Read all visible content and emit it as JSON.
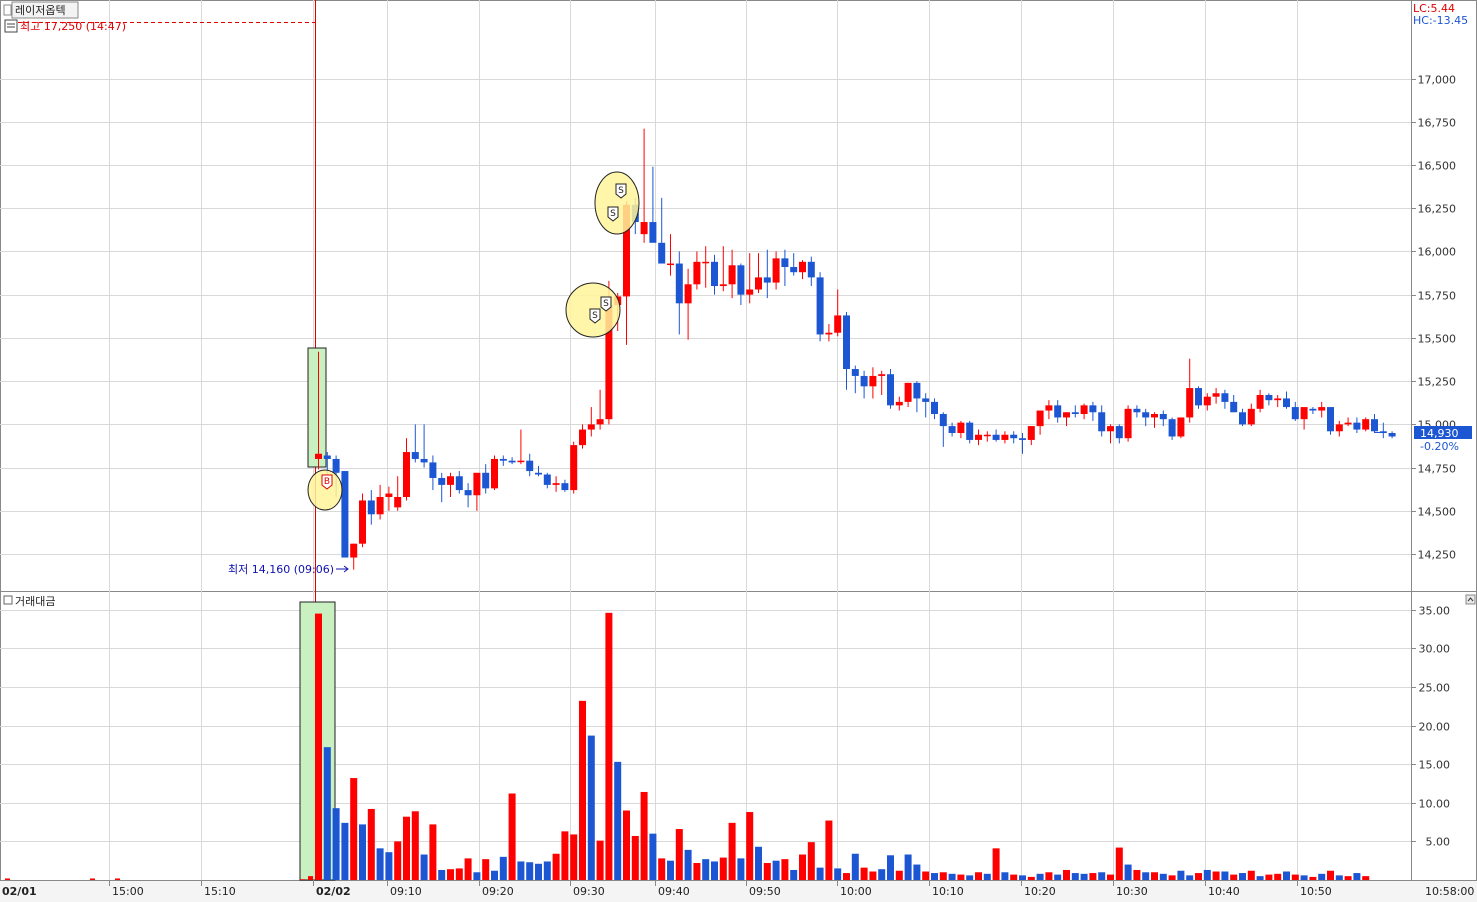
{
  "colors": {
    "up": "#ff0000",
    "down": "#1c56d2",
    "grid": "#d9d9d9",
    "highlight": "#c8f0c0",
    "marker_fill": "#fff59a"
  },
  "legend": {
    "stock_name": "레이저옵텍",
    "high_label": "최고 17,250 (14:47)",
    "low_label": "최저 14,160 (09:06)",
    "lc": "LC:5.44",
    "hc": "HC:-13.45",
    "current_price": "14,930",
    "current_change": "-0.20%",
    "volume_panel": "거래대금"
  },
  "chart_data": [
    {
      "type": "candlestick",
      "price_axis": {
        "min": 14100,
        "max": 17350,
        "ticks": [
          "14,250",
          "14,500",
          "14,750",
          "15,000",
          "15,250",
          "15,500",
          "15,750",
          "16,000",
          "16,250",
          "16,500",
          "16,750",
          "17,000"
        ]
      },
      "x_tick_labels": [
        "02/01",
        "15:00",
        "15:10",
        "02/02",
        "09:10",
        "09:20",
        "09:30",
        "09:40",
        "09:50",
        "10:00",
        "10:10",
        "10:20",
        "10:30",
        "10:40",
        "10:50",
        "10:58:00"
      ],
      "ohlc": [
        [
          14800,
          15420,
          14740,
          14830
        ],
        [
          14820,
          14840,
          14700,
          14800
        ],
        [
          14800,
          14820,
          14580,
          14720
        ],
        [
          14730,
          14730,
          14230,
          14230
        ],
        [
          14230,
          14310,
          14160,
          14310
        ],
        [
          14310,
          14600,
          14290,
          14560
        ],
        [
          14560,
          14620,
          14420,
          14480
        ],
        [
          14480,
          14650,
          14450,
          14580
        ],
        [
          14580,
          14640,
          14500,
          14600
        ],
        [
          14520,
          14700,
          14500,
          14580
        ],
        [
          14580,
          14920,
          14560,
          14840
        ],
        [
          14840,
          15000,
          14780,
          14800
        ],
        [
          14800,
          15000,
          14750,
          14780
        ],
        [
          14780,
          14820,
          14620,
          14690
        ],
        [
          14690,
          14720,
          14550,
          14650
        ],
        [
          14650,
          14720,
          14580,
          14700
        ],
        [
          14700,
          14730,
          14600,
          14620
        ],
        [
          14620,
          14660,
          14520,
          14590
        ],
        [
          14590,
          14700,
          14500,
          14720
        ],
        [
          14720,
          14770,
          14600,
          14630
        ],
        [
          14630,
          14820,
          14620,
          14800
        ],
        [
          14800,
          14820,
          14760,
          14790
        ],
        [
          14790,
          14810,
          14770,
          14780
        ],
        [
          14790,
          14970,
          14770,
          14790
        ],
        [
          14790,
          14830,
          14700,
          14730
        ],
        [
          14720,
          14760,
          14700,
          14710
        ],
        [
          14710,
          14720,
          14630,
          14650
        ],
        [
          14650,
          14700,
          14610,
          14660
        ],
        [
          14660,
          14680,
          14610,
          14620
        ],
        [
          14620,
          14900,
          14600,
          14880
        ],
        [
          14880,
          15000,
          14860,
          14970
        ],
        [
          14970,
          15100,
          14930,
          15000
        ],
        [
          15000,
          15200,
          14970,
          15030
        ],
        [
          15030,
          15830,
          15000,
          15690
        ],
        [
          15690,
          15760,
          15540,
          15740
        ],
        [
          15740,
          16290,
          15460,
          16270
        ],
        [
          16270,
          16310,
          16100,
          16170
        ],
        [
          16100,
          16710,
          16050,
          16170
        ],
        [
          16170,
          16490,
          16110,
          16050
        ],
        [
          16050,
          16310,
          15960,
          15930
        ],
        [
          15930,
          16100,
          15860,
          15930
        ],
        [
          15930,
          16000,
          15520,
          15700
        ],
        [
          15700,
          15900,
          15490,
          15810
        ],
        [
          15810,
          16000,
          15780,
          15940
        ],
        [
          15940,
          16030,
          15790,
          15940
        ],
        [
          15940,
          15980,
          15750,
          15800
        ],
        [
          15800,
          16030,
          15770,
          15810
        ],
        [
          15810,
          16010,
          15730,
          15920
        ],
        [
          15920,
          15930,
          15690,
          15750
        ],
        [
          15750,
          15990,
          15700,
          15780
        ],
        [
          15780,
          15990,
          15760,
          15850
        ],
        [
          15850,
          16010,
          15730,
          15820
        ],
        [
          15820,
          16000,
          15780,
          15960
        ],
        [
          15960,
          16010,
          15800,
          15910
        ],
        [
          15910,
          15990,
          15860,
          15880
        ],
        [
          15880,
          15950,
          15840,
          15940
        ],
        [
          15940,
          15970,
          15800,
          15850
        ],
        [
          15850,
          15880,
          15480,
          15520
        ],
        [
          15520,
          15580,
          15480,
          15530
        ],
        [
          15530,
          15780,
          15510,
          15630
        ],
        [
          15630,
          15650,
          15200,
          15320
        ],
        [
          15320,
          15340,
          15180,
          15280
        ],
        [
          15280,
          15310,
          15150,
          15220
        ],
        [
          15220,
          15330,
          15150,
          15280
        ],
        [
          15280,
          15310,
          15170,
          15290
        ],
        [
          15290,
          15320,
          15090,
          15110
        ],
        [
          15110,
          15160,
          15080,
          15130
        ],
        [
          15130,
          15240,
          15100,
          15240
        ],
        [
          15240,
          15250,
          15070,
          15150
        ],
        [
          15150,
          15180,
          15040,
          15130
        ],
        [
          15130,
          15150,
          15030,
          15060
        ],
        [
          15060,
          15070,
          14870,
          14990
        ],
        [
          14990,
          15010,
          14930,
          14950
        ],
        [
          14950,
          15020,
          14920,
          15010
        ],
        [
          15010,
          15020,
          14890,
          14910
        ],
        [
          14910,
          14970,
          14880,
          14940
        ],
        [
          14940,
          14960,
          14900,
          14940
        ],
        [
          14940,
          14970,
          14900,
          14910
        ],
        [
          14910,
          14960,
          14890,
          14940
        ],
        [
          14940,
          14960,
          14890,
          14920
        ],
        [
          14920,
          14950,
          14830,
          14910
        ],
        [
          14910,
          14990,
          14880,
          14990
        ],
        [
          14990,
          15050,
          14940,
          15080
        ],
        [
          15080,
          15140,
          15030,
          15110
        ],
        [
          15110,
          15140,
          15010,
          15040
        ],
        [
          15040,
          15070,
          14990,
          15070
        ],
        [
          15070,
          15110,
          15040,
          15060
        ],
        [
          15060,
          15120,
          15030,
          15110
        ],
        [
          15110,
          15130,
          15020,
          15070
        ],
        [
          15070,
          15110,
          14930,
          14960
        ],
        [
          14960,
          15000,
          14890,
          14990
        ],
        [
          14990,
          15000,
          14890,
          14920
        ],
        [
          14920,
          15110,
          14900,
          15090
        ],
        [
          15090,
          15110,
          15040,
          15070
        ],
        [
          15070,
          15090,
          14990,
          15040
        ],
        [
          15040,
          15070,
          14980,
          15060
        ],
        [
          15060,
          15080,
          14990,
          15030
        ],
        [
          15030,
          15040,
          14910,
          14930
        ],
        [
          14930,
          15020,
          14920,
          15040
        ],
        [
          15040,
          15380,
          15010,
          15210
        ],
        [
          15210,
          15220,
          15090,
          15110
        ],
        [
          15110,
          15180,
          15080,
          15160
        ],
        [
          15160,
          15210,
          15120,
          15180
        ],
        [
          15180,
          15200,
          15090,
          15130
        ],
        [
          15130,
          15170,
          15080,
          15070
        ],
        [
          15070,
          15090,
          14990,
          15000
        ],
        [
          15000,
          15120,
          14990,
          15090
        ],
        [
          15090,
          15200,
          15070,
          15170
        ],
        [
          15170,
          15180,
          15110,
          15140
        ],
        [
          15140,
          15170,
          15100,
          15150
        ],
        [
          15150,
          15190,
          15090,
          15100
        ],
        [
          15100,
          15130,
          15020,
          15030
        ],
        [
          15030,
          15090,
          14970,
          15100
        ],
        [
          15090,
          15100,
          15060,
          15080
        ],
        [
          15080,
          15130,
          15040,
          15100
        ],
        [
          15100,
          15100,
          14940,
          14960
        ],
        [
          14960,
          15020,
          14930,
          15000
        ],
        [
          15000,
          15040,
          14990,
          15010
        ],
        [
          15010,
          15040,
          14950,
          14970
        ],
        [
          14970,
          15040,
          14960,
          15030
        ],
        [
          15030,
          15060,
          14950,
          14960
        ],
        [
          14960,
          15010,
          14920,
          14950
        ],
        [
          14950,
          14960,
          14920,
          14930
        ]
      ],
      "signals": [
        {
          "label": "B",
          "bar": 0
        },
        {
          "label": "S",
          "bar": 34
        },
        {
          "label": "S",
          "bar": 34
        },
        {
          "label": "S",
          "bar": 37
        },
        {
          "label": "S",
          "bar": 36
        }
      ]
    },
    {
      "type": "bar",
      "title": "거래대금",
      "y_axis": {
        "min": 0,
        "max": 36,
        "ticks": [
          "5.00",
          "10.00",
          "15.00",
          "20.00",
          "25.00",
          "30.00",
          "35.00"
        ]
      },
      "values": [
        34.5,
        17.2,
        9.3,
        7.4,
        13.2,
        7.2,
        9.2,
        4.1,
        3.6,
        5.0,
        8.2,
        8.9,
        3.3,
        7.2,
        1.3,
        1.4,
        1.5,
        2.8,
        1.0,
        2.7,
        1.2,
        3.0,
        11.2,
        2.4,
        2.3,
        2.1,
        2.4,
        3.4,
        6.3,
        5.9,
        23.2,
        18.7,
        5.1,
        34.6,
        15.3,
        9.0,
        5.7,
        11.4,
        6.0,
        2.8,
        2.5,
        6.6,
        3.9,
        2.2,
        2.7,
        2.4,
        2.9,
        7.4,
        2.8,
        8.8,
        4.3,
        2.2,
        2.5,
        2.7,
        1.3,
        3.3,
        4.9,
        1.6,
        7.7,
        1.5,
        0.9,
        3.4,
        1.6,
        1.1,
        1.4,
        3.2,
        1.2,
        3.3,
        2.0,
        1.1,
        0.9,
        1.0,
        0.8,
        0.7,
        0.6,
        1.0,
        0.8,
        4.1,
        1.0,
        0.7,
        0.6,
        0.4,
        0.8,
        1.0,
        0.7,
        1.3,
        0.9,
        0.8,
        0.9,
        1.0,
        0.7,
        4.2,
        2.0,
        1.3,
        1.0,
        1.0,
        0.8,
        0.6,
        1.2,
        0.6,
        0.9,
        1.3,
        1.1,
        1.1,
        0.7,
        0.9,
        1.2,
        0.5,
        0.7,
        0.8,
        1.1,
        0.7,
        0.6,
        0.4,
        0.8,
        1.2,
        0.6,
        0.5,
        0.9,
        0.5
      ],
      "directions": [
        "up",
        "down",
        "down",
        "down",
        "up",
        "down",
        "up",
        "down",
        "down",
        "up",
        "up",
        "up",
        "down",
        "up",
        "down",
        "up",
        "up",
        "up",
        "down",
        "up",
        "down",
        "down",
        "up",
        "down",
        "down",
        "down",
        "down",
        "up",
        "up",
        "up",
        "up",
        "down",
        "up",
        "up",
        "down",
        "up",
        "up",
        "up",
        "down",
        "up",
        "down",
        "up",
        "down",
        "up",
        "down",
        "down",
        "up",
        "up",
        "down",
        "up",
        "down",
        "up",
        "down",
        "up",
        "down",
        "up",
        "up",
        "down",
        "up",
        "down",
        "up",
        "down",
        "up",
        "up",
        "down",
        "down",
        "up",
        "down",
        "down",
        "up",
        "down",
        "up",
        "down",
        "up",
        "down",
        "up",
        "down",
        "up",
        "down",
        "up",
        "down",
        "up",
        "down",
        "up",
        "down",
        "up",
        "down",
        "down",
        "up",
        "down",
        "up",
        "up",
        "down",
        "up",
        "down",
        "up",
        "down",
        "up",
        "down",
        "down",
        "up",
        "down",
        "up",
        "down",
        "up",
        "down",
        "up",
        "down",
        "up",
        "up",
        "down",
        "up",
        "down",
        "up",
        "down",
        "up",
        "down",
        "up",
        "down",
        "up"
      ]
    }
  ]
}
